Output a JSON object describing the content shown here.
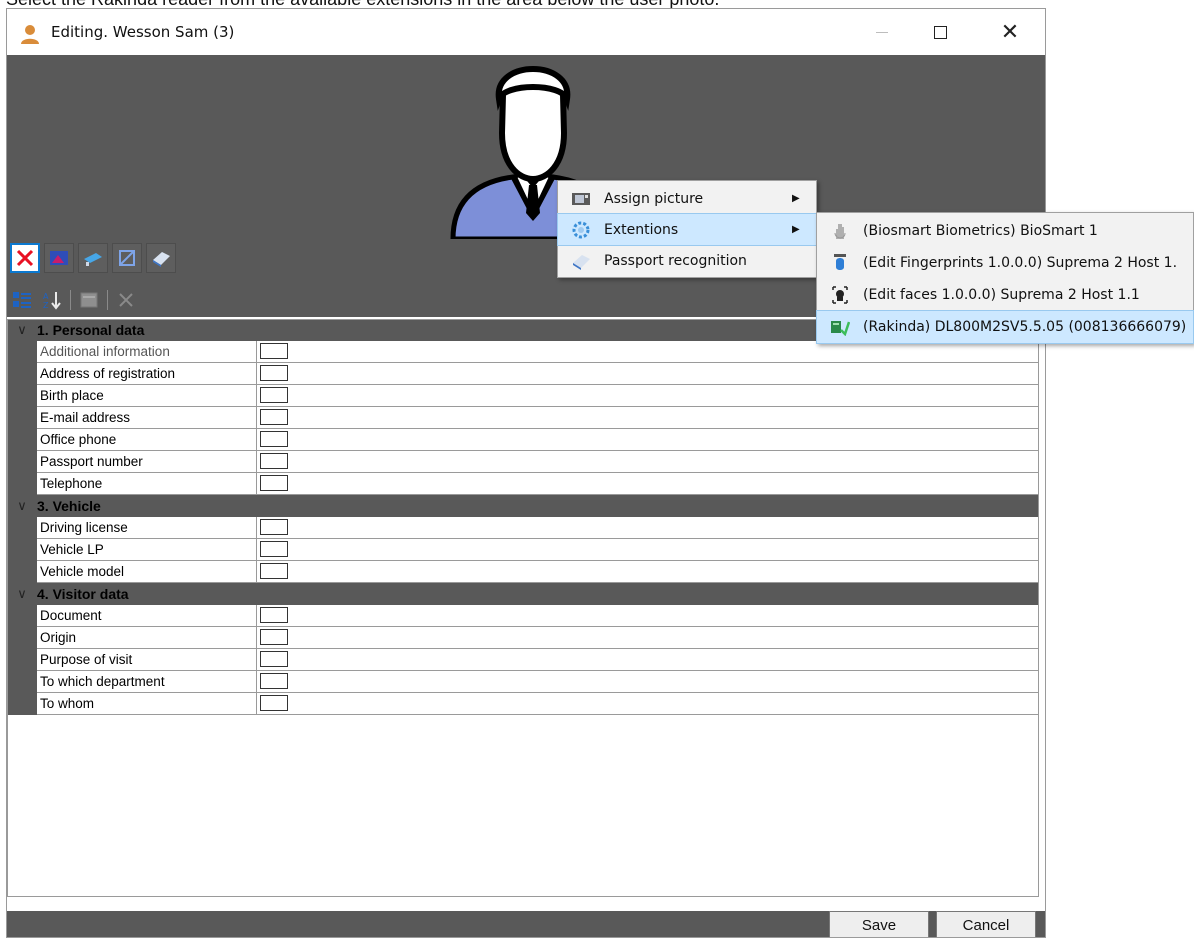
{
  "caption": "Select the Rakinda reader from the available extensions in the area below the user photo.",
  "window": {
    "title": "Editing. Wesson Sam (3)",
    "close_glyph": "✕"
  },
  "groups": [
    {
      "label": "1. Personal data",
      "fields": [
        "Additional information",
        "Address of registration",
        "Birth place",
        "E-mail address",
        "Office phone",
        "Passport number",
        "Telephone"
      ]
    },
    {
      "label": "3. Vehicle",
      "fields": [
        "Driving license",
        "Vehicle LP",
        "Vehicle model"
      ]
    },
    {
      "label": "4. Visitor data",
      "fields": [
        "Document",
        "Origin",
        "Purpose of visit",
        "To which department",
        "To whom"
      ]
    }
  ],
  "context_menu": [
    {
      "label": "Assign picture",
      "icon": "picture-icon",
      "has_submenu": true
    },
    {
      "label": "Extentions",
      "icon": "gear-icon",
      "has_submenu": true,
      "highlighted": true
    },
    {
      "label": "Passport recognition",
      "icon": "scanner-icon",
      "has_submenu": false
    }
  ],
  "submenu": [
    {
      "label": "(Biosmart Biometrics) BioSmart 1",
      "icon": "hand-icon"
    },
    {
      "label": "(Edit Fingerprints 1.0.0.0) Suprema 2 Host 1.",
      "icon": "fingerprint-icon"
    },
    {
      "label": "(Edit faces 1.0.0.0) Suprema 2 Host 1.1",
      "icon": "face-icon"
    },
    {
      "label": "(Rakinda) DL800M2SV5.5.05 (008136666079)",
      "icon": "reader-icon",
      "highlighted": true
    }
  ],
  "footer": {
    "save_label": "Save",
    "cancel_label": "Cancel"
  },
  "colors": {
    "panel": "#595959",
    "highlight": "#cde8ff",
    "delete_red": "#e81123"
  }
}
